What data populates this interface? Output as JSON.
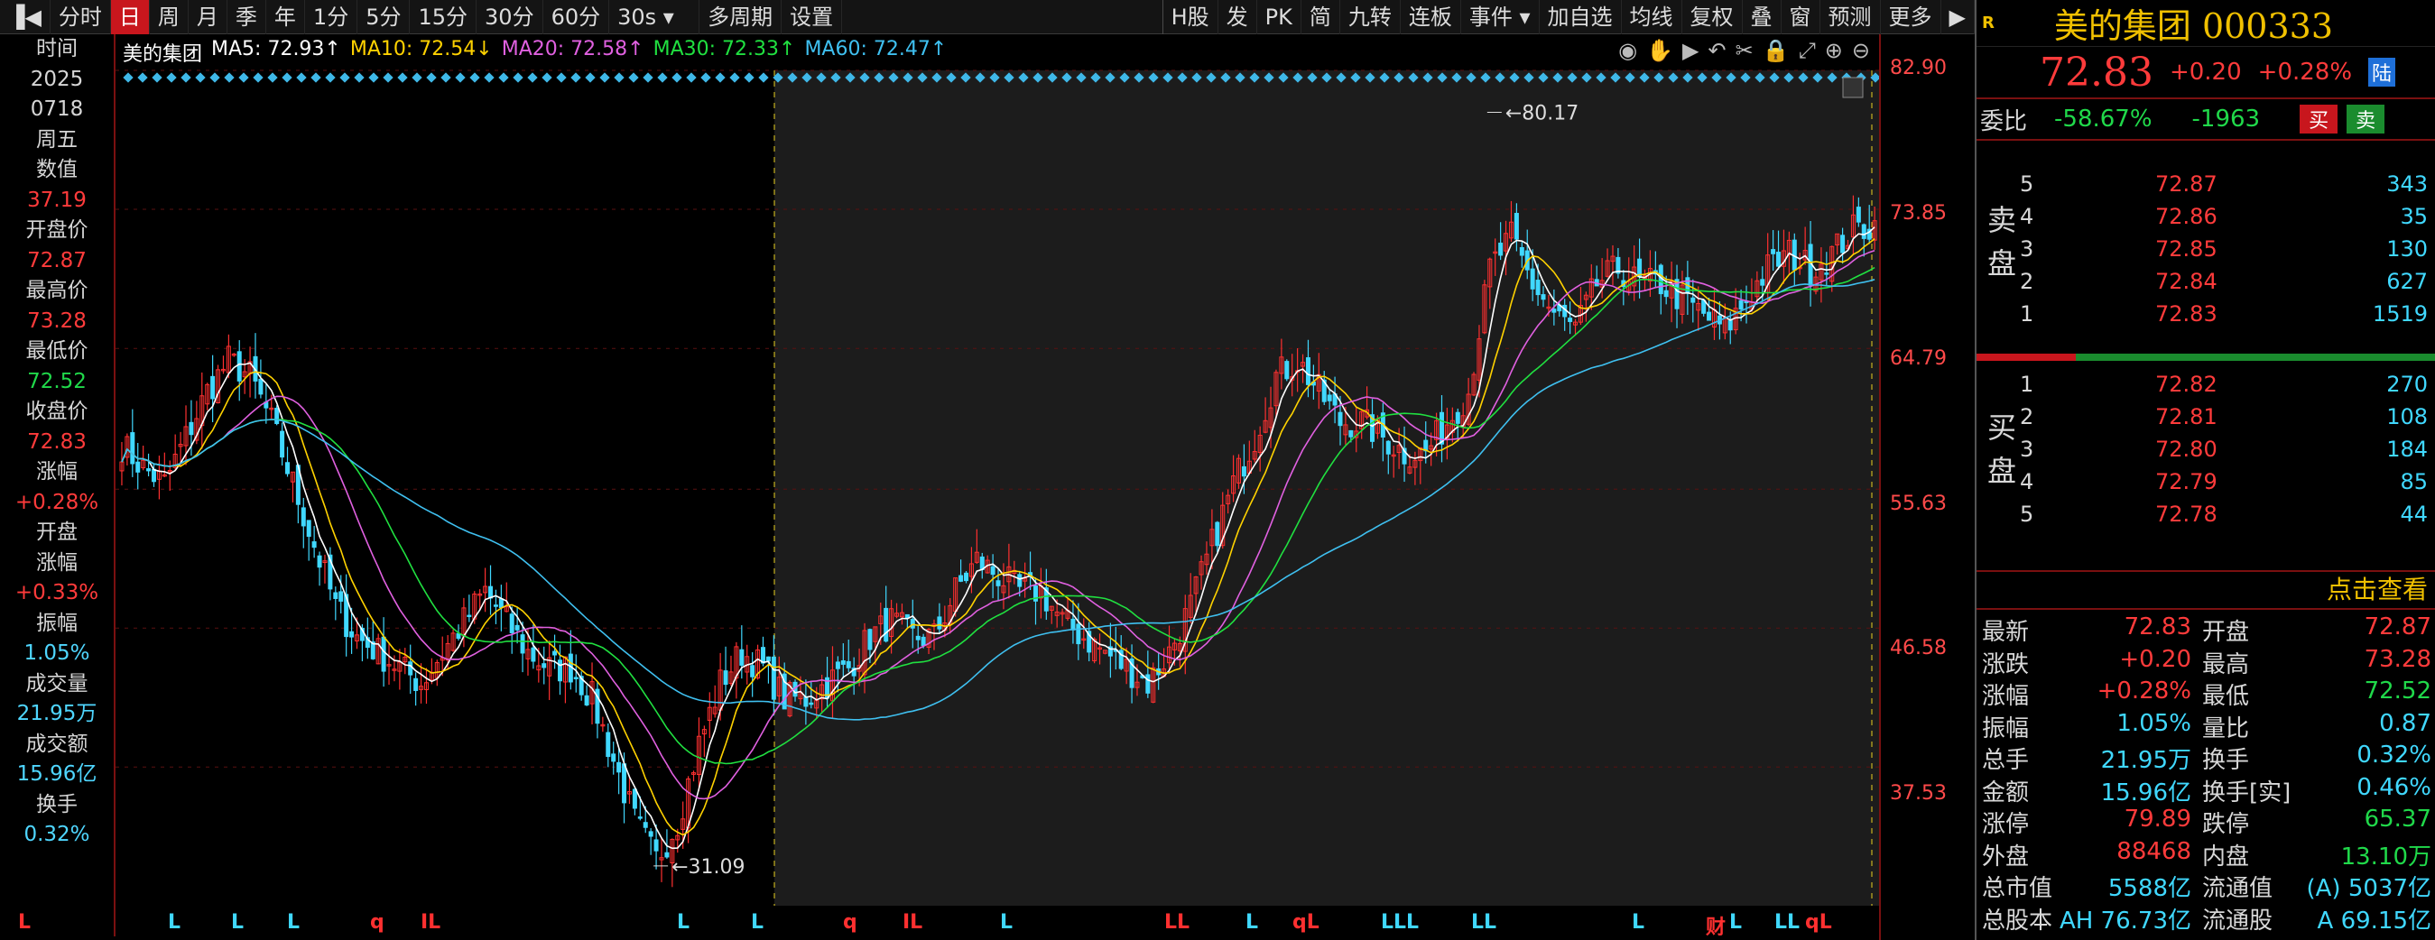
{
  "toolbar": {
    "items": [
      "分时",
      "日",
      "周",
      "月",
      "季",
      "年",
      "1分",
      "5分",
      "15分",
      "30分",
      "60分",
      "30s ▾",
      "多周期",
      "设置"
    ],
    "active": "日",
    "right_items": [
      "H股",
      "发",
      "PK",
      "简",
      "九转",
      "连板",
      "事件 ▾",
      "加自选",
      "均线",
      "复权",
      "叠",
      "窗",
      "预测",
      "更多",
      "▶"
    ]
  },
  "info_panel": {
    "time_label": "时间",
    "year": "2025",
    "date": "0718",
    "weekday": "周五",
    "value_label": "数值",
    "value": "37.19",
    "open_label": "开盘价",
    "open": "72.87",
    "high_label": "最高价",
    "high": "73.28",
    "low_label": "最低价",
    "low": "72.52",
    "close_label": "收盘价",
    "close": "72.83",
    "change_label": "涨幅",
    "change": "+0.28%",
    "open_chg_label1": "开盘",
    "open_chg_label2": "涨幅",
    "open_chg": "+0.33%",
    "amp_label": "振幅",
    "amp": "1.05%",
    "vol_label": "成交量",
    "vol": "21.95万",
    "amt_label": "成交额",
    "amt": "15.96亿",
    "turn_label": "换手",
    "turn": "0.32%"
  },
  "legend": {
    "name": "美的集团",
    "ma5": "MA5: 72.93↑",
    "ma10": "MA10: 72.54↓",
    "ma20": "MA20: 72.58↑",
    "ma30": "MA30: 72.33↑",
    "ma60": "MA60: 72.47↑"
  },
  "colors": {
    "ma5": "#ffffff",
    "ma10": "#ffd200",
    "ma20": "#e060e0",
    "ma30": "#20e040",
    "ma60": "#3fc0f0",
    "up": "#ff3030",
    "down": "#40d8ff"
  },
  "chart_data": {
    "type": "candlestick",
    "y_ticks": [
      "82.90",
      "73.85",
      "64.79",
      "55.63",
      "46.58",
      "37.53"
    ],
    "ylim": [
      28.5,
      82.9
    ],
    "annotations": {
      "high": "80.17",
      "low": "31.09"
    },
    "close_path": [
      [
        0,
        58.5
      ],
      [
        4,
        57
      ],
      [
        8,
        56
      ],
      [
        12,
        59
      ],
      [
        16,
        62
      ],
      [
        20,
        64
      ],
      [
        24,
        63
      ],
      [
        28,
        60
      ],
      [
        32,
        56
      ],
      [
        36,
        52
      ],
      [
        40,
        48
      ],
      [
        44,
        46
      ],
      [
        48,
        45
      ],
      [
        52,
        44
      ],
      [
        56,
        43
      ],
      [
        60,
        45
      ],
      [
        64,
        47
      ],
      [
        68,
        49
      ],
      [
        72,
        47
      ],
      [
        76,
        45
      ],
      [
        80,
        44
      ],
      [
        84,
        44
      ],
      [
        88,
        42
      ],
      [
        92,
        38
      ],
      [
        96,
        34
      ],
      [
        100,
        31.5
      ],
      [
        104,
        34
      ],
      [
        108,
        39
      ],
      [
        112,
        43
      ],
      [
        116,
        45
      ],
      [
        120,
        44
      ],
      [
        124,
        42
      ],
      [
        128,
        42
      ],
      [
        132,
        43
      ],
      [
        136,
        44
      ],
      [
        140,
        46
      ],
      [
        144,
        47
      ],
      [
        148,
        46
      ],
      [
        152,
        46
      ],
      [
        156,
        49
      ],
      [
        160,
        51
      ],
      [
        164,
        50
      ],
      [
        168,
        49
      ],
      [
        172,
        49
      ],
      [
        176,
        47
      ],
      [
        180,
        46
      ],
      [
        184,
        45
      ],
      [
        188,
        44
      ],
      [
        192,
        43
      ],
      [
        196,
        45
      ],
      [
        200,
        48
      ],
      [
        204,
        52
      ],
      [
        208,
        56
      ],
      [
        212,
        59
      ],
      [
        216,
        63
      ],
      [
        220,
        64
      ],
      [
        224,
        62
      ],
      [
        228,
        60
      ],
      [
        232,
        60
      ],
      [
        236,
        59
      ],
      [
        240,
        58
      ],
      [
        244,
        58
      ],
      [
        248,
        60
      ],
      [
        252,
        62
      ],
      [
        256,
        70
      ],
      [
        260,
        72
      ],
      [
        264,
        69
      ],
      [
        268,
        67
      ],
      [
        272,
        66
      ],
      [
        276,
        69
      ],
      [
        280,
        70
      ],
      [
        284,
        69
      ],
      [
        288,
        69
      ],
      [
        292,
        68
      ],
      [
        296,
        67
      ],
      [
        300,
        66
      ],
      [
        304,
        68
      ],
      [
        308,
        70
      ],
      [
        312,
        71
      ],
      [
        316,
        70
      ],
      [
        320,
        71
      ],
      [
        324,
        72.5
      ],
      [
        328,
        72.83
      ]
    ],
    "volume_label": "21.95万"
  },
  "bottom_marks": [
    {
      "t": "L",
      "c": "#ff3030"
    },
    {
      "t": "L",
      "c": "#40d8ff"
    },
    {
      "t": "L",
      "c": "#40d8ff"
    },
    {
      "t": "L",
      "c": "#40d8ff"
    },
    {
      "t": "q",
      "c": "#ff3030"
    },
    {
      "t": "IL",
      "c": "#ff3030"
    },
    {
      "t": "L",
      "c": "#40d8ff"
    },
    {
      "t": "L",
      "c": "#40d8ff"
    },
    {
      "t": "q",
      "c": "#ff3030"
    },
    {
      "t": "IL",
      "c": "#ff3030"
    },
    {
      "t": "L",
      "c": "#40d8ff"
    },
    {
      "t": "LL",
      "c": "#ff3030"
    },
    {
      "t": "L",
      "c": "#40d8ff"
    },
    {
      "t": "qL",
      "c": "#ff3030"
    },
    {
      "t": "LLL",
      "c": "#40d8ff"
    },
    {
      "t": "LL",
      "c": "#40d8ff"
    },
    {
      "t": "L",
      "c": "#40d8ff"
    },
    {
      "t": "财",
      "c": "#ff3030"
    },
    {
      "t": "L",
      "c": "#40d8ff"
    },
    {
      "t": "LL",
      "c": "#40d8ff"
    },
    {
      "t": "qL",
      "c": "#ff3030"
    }
  ],
  "right_panel": {
    "r_badge": "R",
    "title": "美的集团 000333",
    "price": "72.83",
    "chg": "+0.20",
    "pct": "+0.28%",
    "market": "陆",
    "weibi_label": "委比",
    "weibi": "-58.67%",
    "weicha": "-1963",
    "buy_btn": "买",
    "sell_btn": "卖",
    "sell_label": "卖盘",
    "buy_label": "买盘",
    "asks": [
      [
        "5",
        "72.87",
        "343"
      ],
      [
        "4",
        "72.86",
        "35"
      ],
      [
        "3",
        "72.85",
        "130"
      ],
      [
        "2",
        "72.84",
        "627"
      ],
      [
        "1",
        "72.83",
        "1519"
      ]
    ],
    "bids": [
      [
        "1",
        "72.82",
        "270"
      ],
      [
        "2",
        "72.81",
        "108"
      ],
      [
        "3",
        "72.80",
        "184"
      ],
      [
        "4",
        "72.79",
        "85"
      ],
      [
        "5",
        "72.78",
        "44"
      ]
    ],
    "click_text": "点击查看",
    "stats": [
      [
        "最新",
        "72.83",
        "开盘",
        "72.87"
      ],
      [
        "涨跌",
        "+0.20",
        "最高",
        "73.28"
      ],
      [
        "涨幅",
        "+0.28%",
        "最低",
        "72.52"
      ],
      [
        "振幅",
        "1.05%",
        "量比",
        "0.87"
      ],
      [
        "总手",
        "21.95万",
        "换手",
        "0.32%"
      ],
      [
        "金额",
        "15.96亿",
        "换手[实]",
        "0.46%"
      ],
      [
        "涨停",
        "79.89",
        "跌停",
        "65.37"
      ],
      [
        "外盘",
        "88468",
        "内盘",
        "13.10万"
      ],
      [
        "总市值",
        "5588亿",
        "流通值",
        "(A) 5037亿"
      ],
      [
        "总股本",
        "AH 76.73亿",
        "流通股",
        "A 69.15亿"
      ]
    ]
  }
}
